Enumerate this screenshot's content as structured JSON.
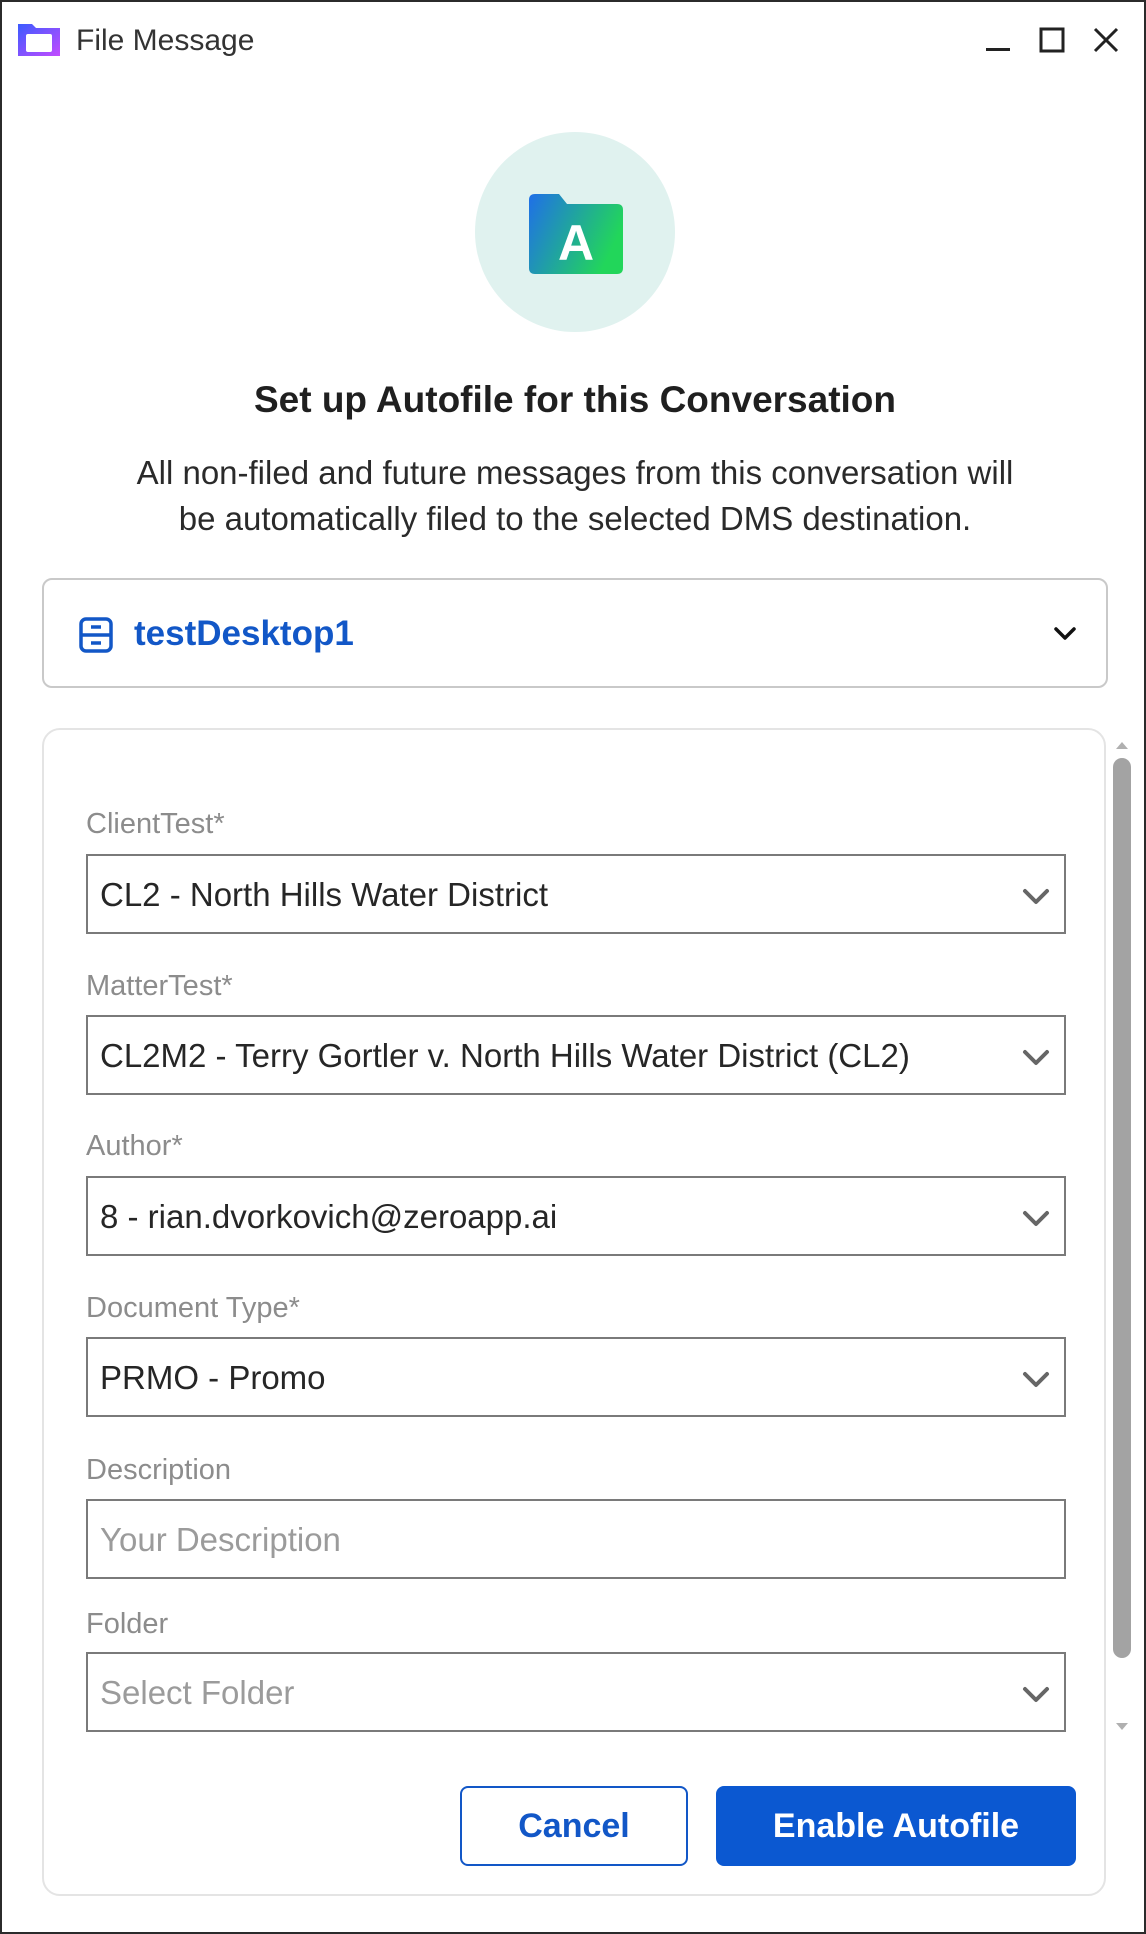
{
  "window": {
    "title": "File Message"
  },
  "hero": {
    "icon_letter": "A",
    "heading": "Set up Autofile for this Conversation",
    "line1": "All non-filed and future messages from this conversation will",
    "line2": "be automatically filed to the selected DMS destination."
  },
  "destination": {
    "label": "testDesktop1"
  },
  "form": {
    "client": {
      "label": "ClientTest*",
      "value": "CL2 - North Hills Water District"
    },
    "matter": {
      "label": "MatterTest*",
      "value": "CL2M2 - Terry Gortler v. North Hills Water District (CL2)"
    },
    "author": {
      "label": "Author*",
      "value": "8 - rian.dvorkovich@zeroapp.ai"
    },
    "doctype": {
      "label": "Document Type*",
      "value": "PRMO - Promo"
    },
    "description": {
      "label": "Description",
      "placeholder": "Your Description"
    },
    "folder": {
      "label": "Folder",
      "placeholder": "Select Folder"
    }
  },
  "buttons": {
    "cancel": "Cancel",
    "enable": "Enable Autofile"
  },
  "colors": {
    "accent": "#0b58d1",
    "hero_bg": "#e0f2ef"
  }
}
